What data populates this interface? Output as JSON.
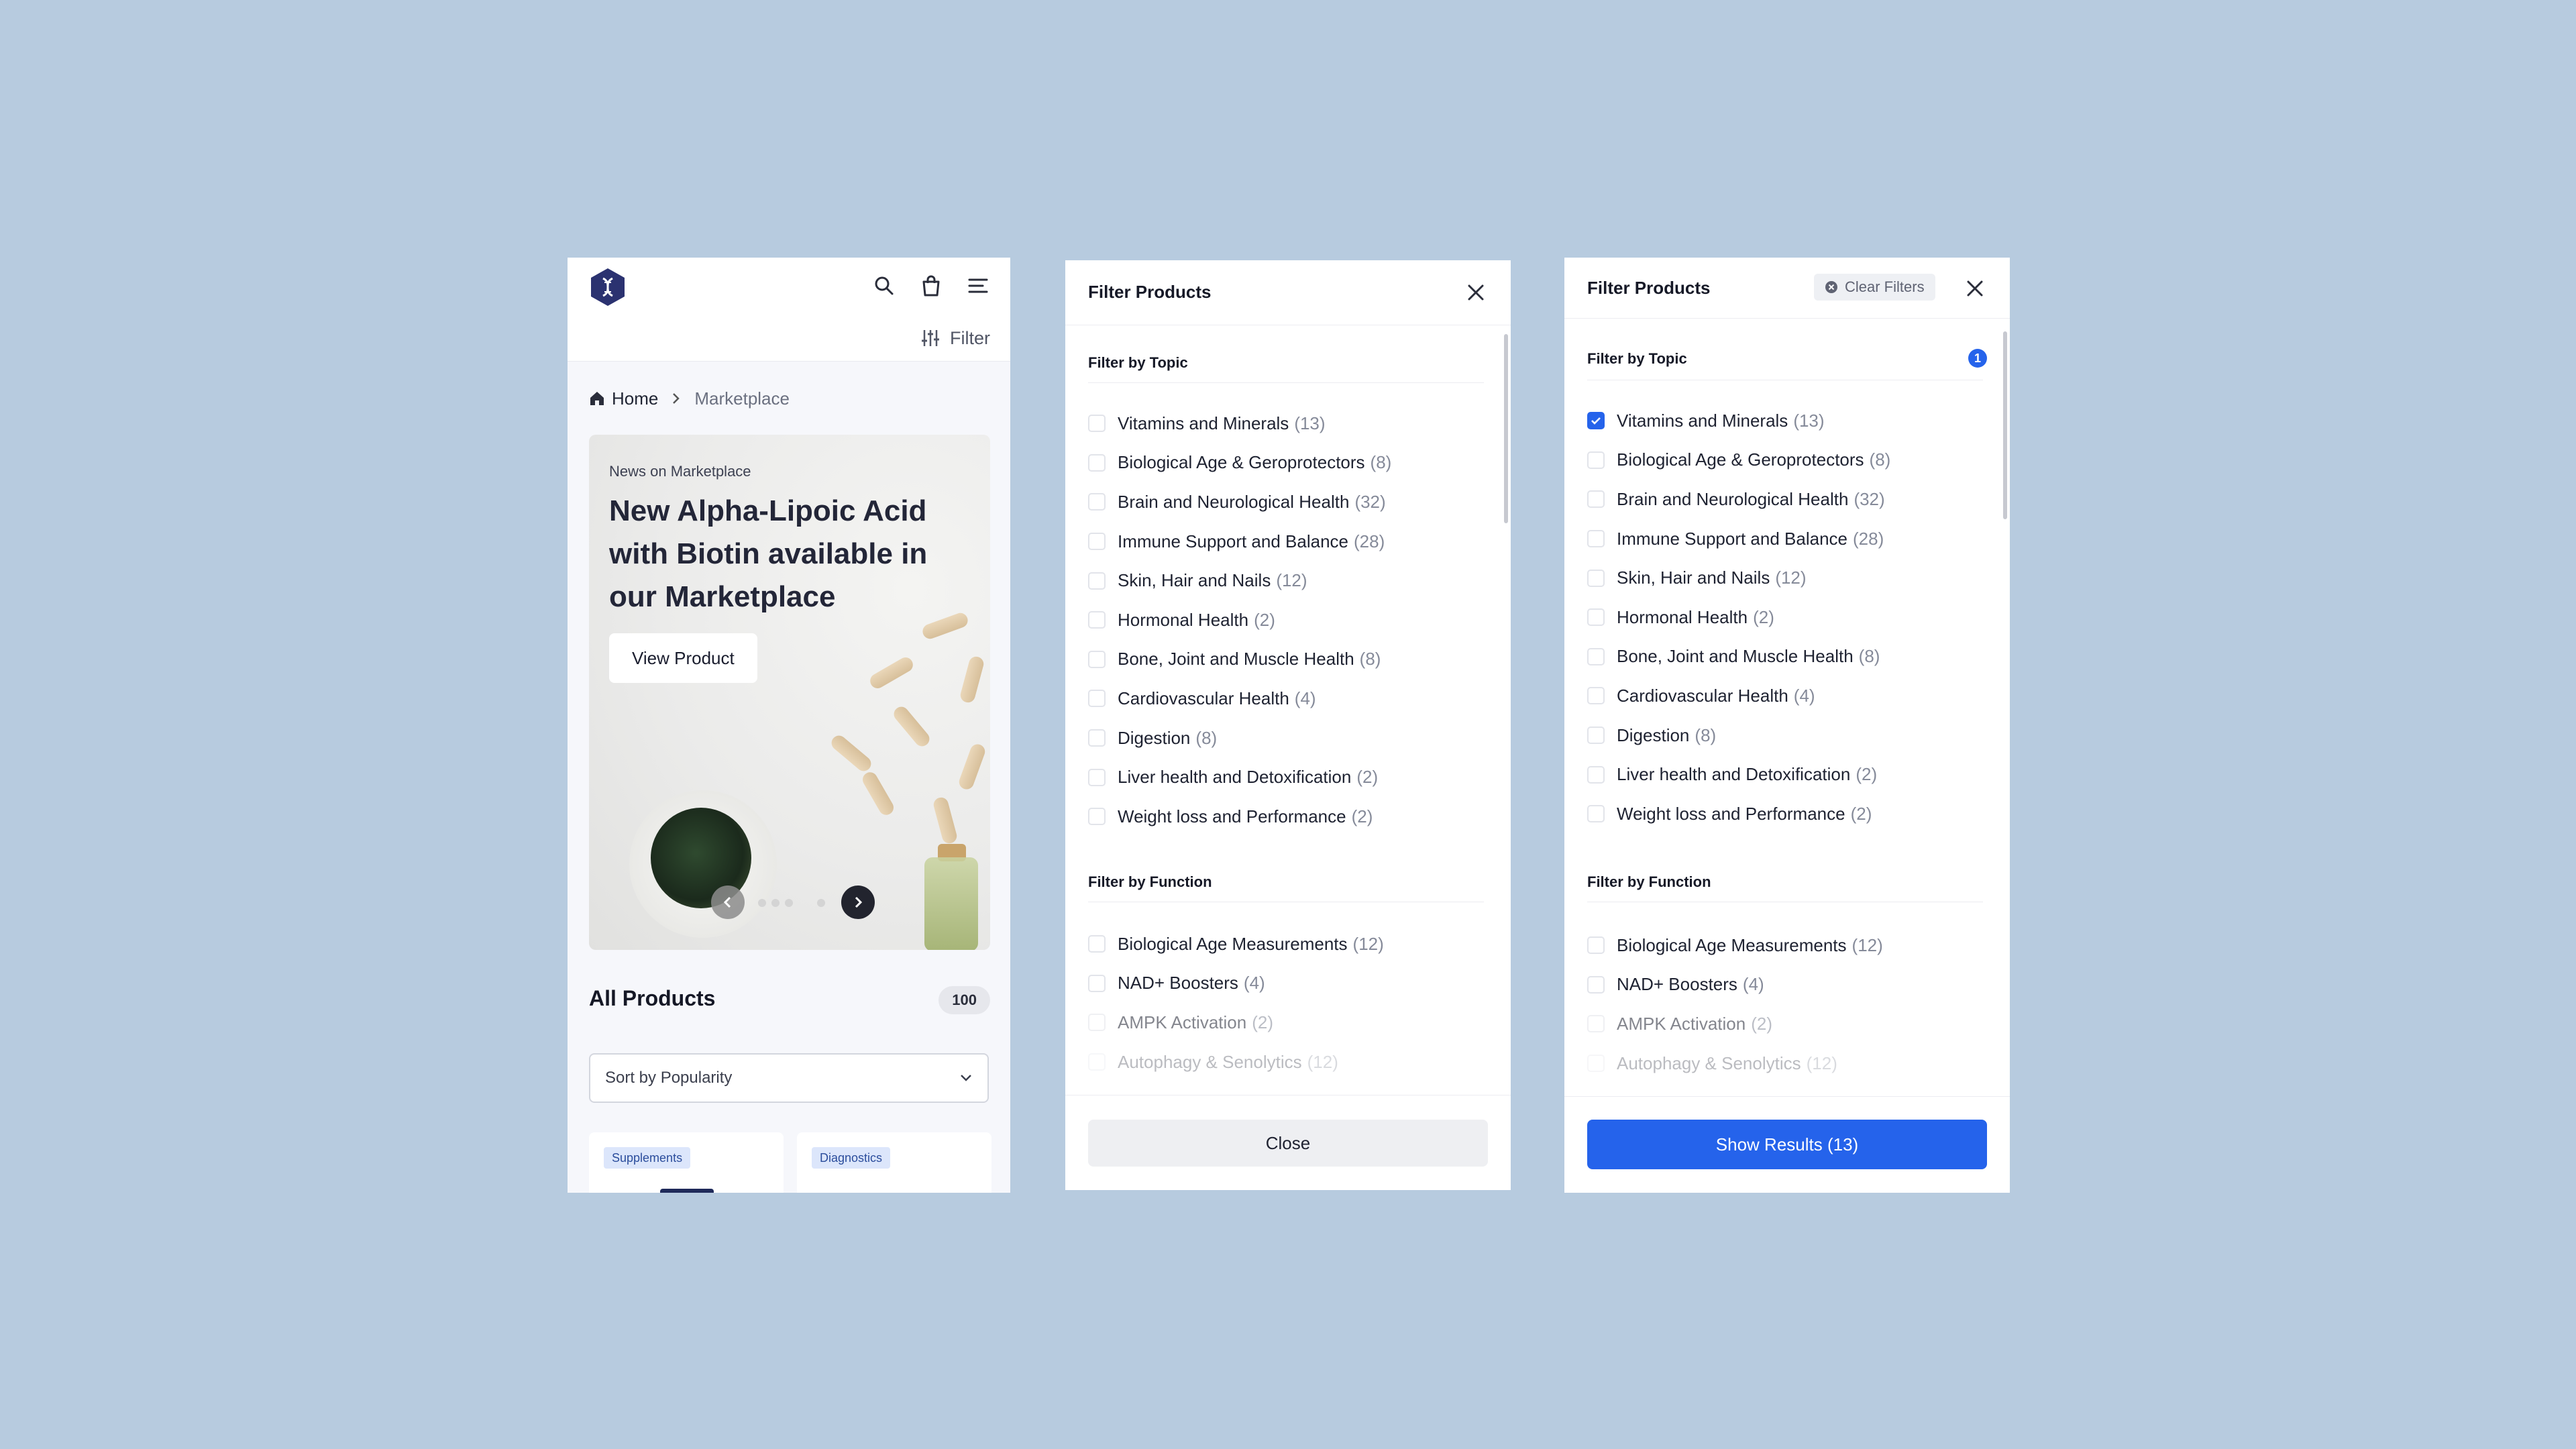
{
  "colors": {
    "accent": "#2563eb",
    "logo": "#2b3270",
    "background": "#b7cbdf"
  },
  "mobile": {
    "header_icons": [
      "search-icon",
      "bag-icon",
      "menu-icon"
    ],
    "filter_label": "Filter",
    "breadcrumb": {
      "home": "Home",
      "current": "Marketplace"
    },
    "hero": {
      "eyebrow": "News on Marketplace",
      "title": "New Alpha-Lipoic Acid with Biotin available in our Marketplace",
      "button": "View Product"
    },
    "all_products": {
      "title": "All Products",
      "count": "100"
    },
    "sort": {
      "value": "Sort by Popularity"
    },
    "cards": [
      {
        "tag": "Supplements"
      },
      {
        "tag": "Diagnostics"
      }
    ]
  },
  "filter_a": {
    "title": "Filter Products",
    "topic_title": "Filter by Topic",
    "function_title": "Filter by Function",
    "footer_button": "Close"
  },
  "filter_b": {
    "title": "Filter Products",
    "clear_label": "Clear Filters",
    "topic_title": "Filter by Topic",
    "topic_selected_count": "1",
    "function_title": "Filter by Function",
    "footer_button": "Show Results (13)"
  },
  "topics": [
    {
      "label": "Vitamins and Minerals",
      "count": "(13)"
    },
    {
      "label": "Biological Age & Geroprotectors",
      "count": "(8)"
    },
    {
      "label": "Brain and Neurological Health",
      "count": "(32)"
    },
    {
      "label": "Immune Support and Balance",
      "count": "(28)"
    },
    {
      "label": "Skin, Hair and Nails",
      "count": "(12)"
    },
    {
      "label": "Hormonal Health",
      "count": "(2)"
    },
    {
      "label": "Bone, Joint and Muscle Health",
      "count": "(8)"
    },
    {
      "label": "Cardiovascular Health",
      "count": "(4)"
    },
    {
      "label": "Digestion",
      "count": "(8)"
    },
    {
      "label": "Liver health and Detoxification",
      "count": "(2)"
    },
    {
      "label": "Weight loss and Performance",
      "count": "(2)"
    }
  ],
  "functions": [
    {
      "label": "Biological Age Measurements",
      "count": "(12)"
    },
    {
      "label": "NAD+ Boosters",
      "count": "(4)"
    },
    {
      "label": "AMPK Activation",
      "count": "(2)"
    },
    {
      "label": "Autophagy & Senolytics",
      "count": "(12)"
    }
  ]
}
